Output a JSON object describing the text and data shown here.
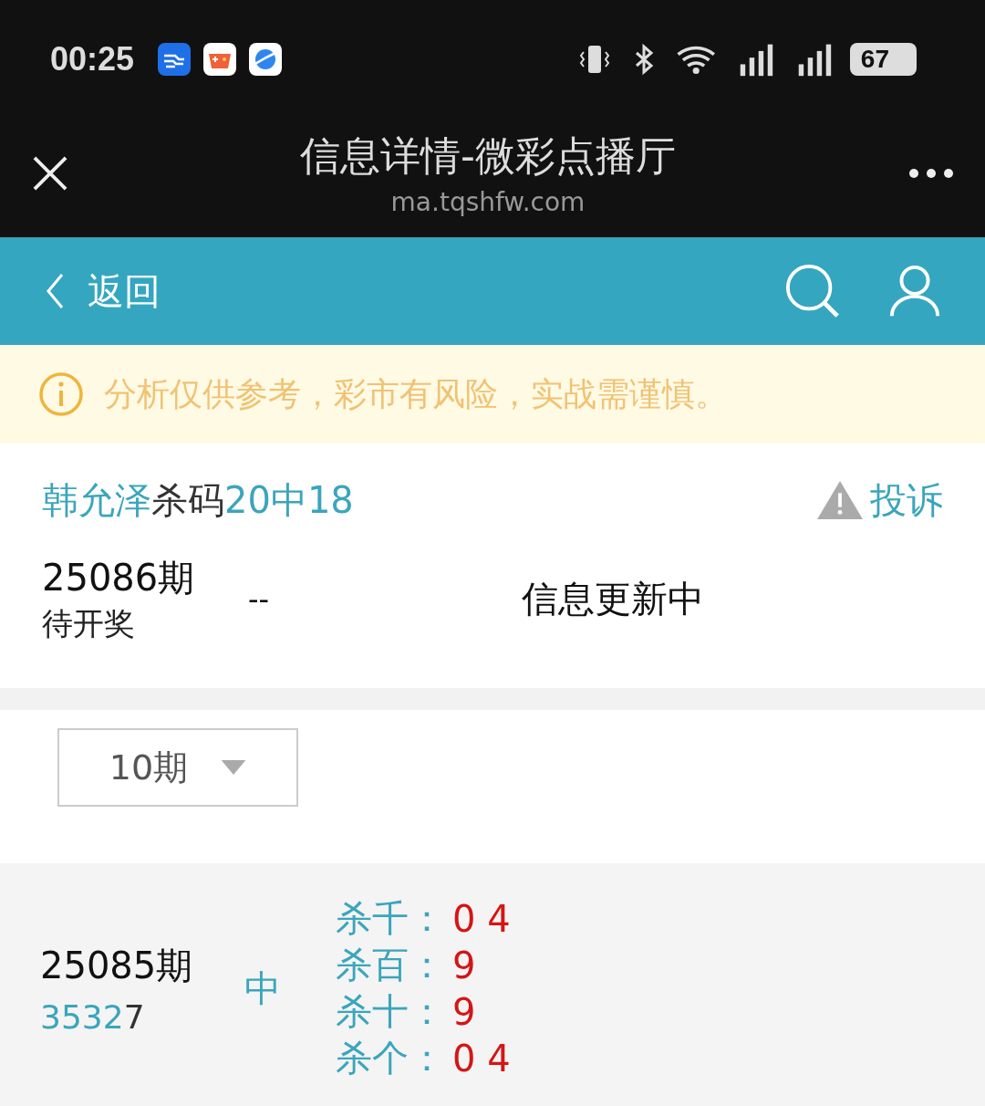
{
  "status_bar": {
    "time": "00:25",
    "battery": "67"
  },
  "browser": {
    "title": "信息详情-微彩点播厅",
    "url": "ma.tqshfw.com"
  },
  "nav": {
    "back": "返回"
  },
  "notice": "分析仅供参考，彩市有风险，实战需谨慎。",
  "post": {
    "author": "韩允泽",
    "category": "杀码",
    "record": "20中18",
    "complaint": "投诉"
  },
  "current": {
    "issue": "25086期",
    "status": "待开奖",
    "result": "--",
    "info": "信息更新中"
  },
  "filter": {
    "value": "10期"
  },
  "history": [
    {
      "issue": "25085期",
      "digits": [
        {
          "d": "3",
          "hit": true
        },
        {
          "d": "5",
          "hit": true
        },
        {
          "d": "3",
          "hit": true
        },
        {
          "d": "2",
          "hit": true
        },
        {
          "d": "7",
          "hit": false
        }
      ],
      "verdict": "中",
      "picks": [
        {
          "label": "杀千：",
          "value": "0 4"
        },
        {
          "label": "杀百：",
          "value": "9"
        },
        {
          "label": "杀十：",
          "value": "9"
        },
        {
          "label": "杀个：",
          "value": "0 4"
        }
      ]
    }
  ]
}
